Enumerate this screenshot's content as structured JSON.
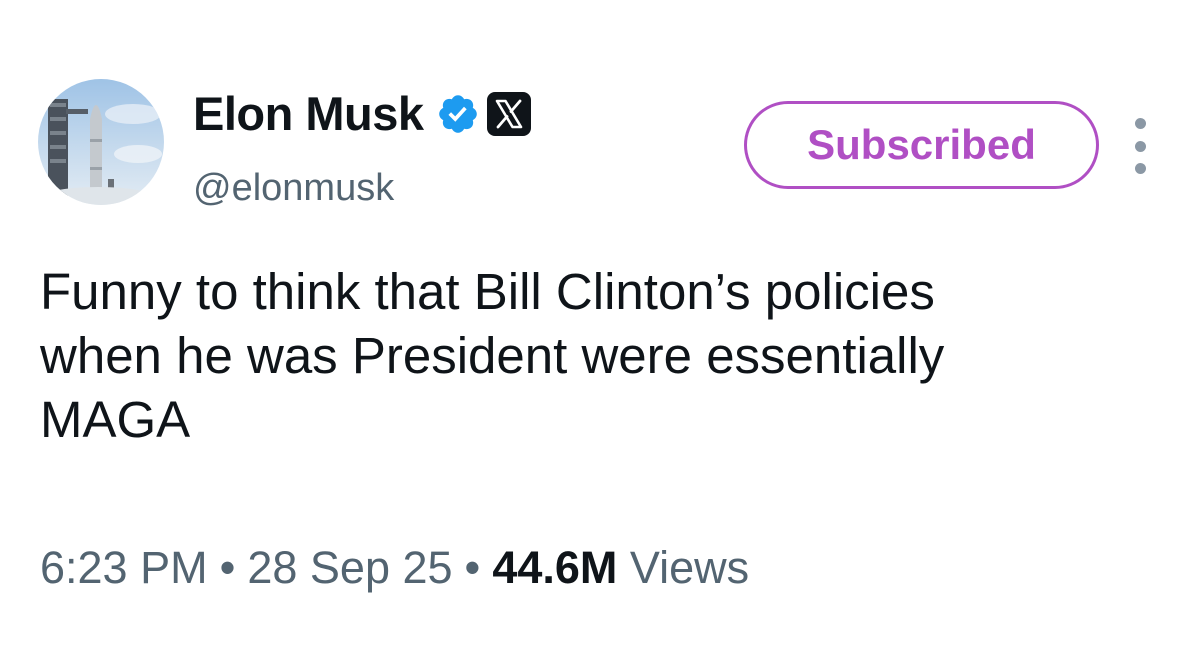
{
  "tweet": {
    "author": {
      "display_name": "Elon Musk",
      "handle": "@elonmusk",
      "verified_icon": "verified-check-icon",
      "affiliation_icon": "x-logo-icon"
    },
    "subscribe_button": {
      "label": "Subscribed",
      "color": "#b04fc4"
    },
    "more_icon": "more-vertical-icon",
    "text": "Funny to think that Bill Clinton’s policies\nwhen he was President were essentially\nMAGA",
    "meta": {
      "time": "6:23 PM",
      "separator": "•",
      "date": "28 Sep 25",
      "views_count": "44.6M",
      "views_label": "Views"
    }
  },
  "colors": {
    "primary_text": "#0f1419",
    "secondary_text": "#536471",
    "verified_blue": "#1d9bf0",
    "subscribed_purple": "#b04fc4",
    "background": "#ffffff"
  }
}
